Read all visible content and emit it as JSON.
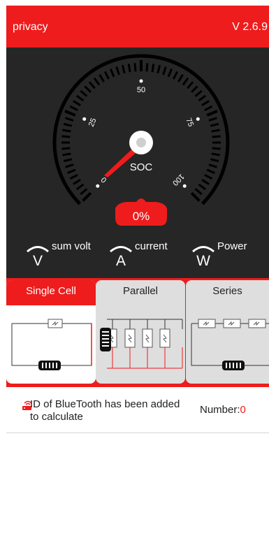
{
  "header": {
    "title": "privacy",
    "version": "V 2.6.9"
  },
  "gauge": {
    "label": "SOC",
    "value_text": "0%",
    "soc_percent": 0,
    "ticks": [
      "0",
      "25",
      "50",
      "75",
      "100"
    ]
  },
  "metrics": [
    {
      "label": "sum volt",
      "icon": "volt-icon",
      "letter": "V"
    },
    {
      "label": "current",
      "icon": "current-icon",
      "letter": "A"
    },
    {
      "label": "Power",
      "icon": "power-icon",
      "letter": "W"
    }
  ],
  "modes": [
    {
      "label": "Single Cell",
      "active": true
    },
    {
      "label": "Parallel",
      "active": false
    },
    {
      "label": "Series",
      "active": false
    }
  ],
  "bluetooth": {
    "message": "ID of BlueTooth has been added to calculate",
    "number_label": "Number:",
    "number_value": "0"
  },
  "colors": {
    "accent": "#ee1c1c",
    "dark": "#262626"
  }
}
